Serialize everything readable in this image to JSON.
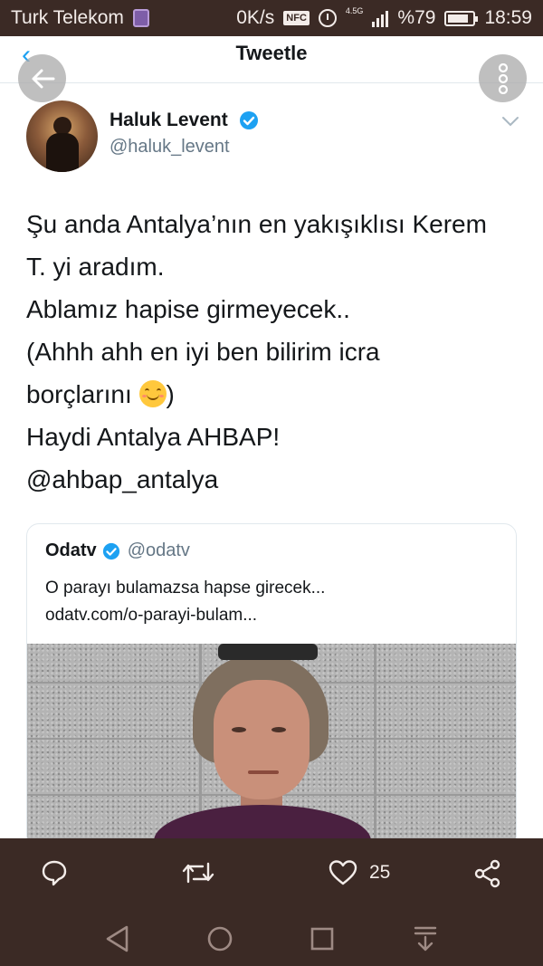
{
  "status_bar": {
    "carrier": "Turk Telekom",
    "speed": "0K/s",
    "nfc": "NFC",
    "network": "4.5G",
    "battery": "%79",
    "time": "18:59"
  },
  "header": {
    "title": "Tweetle"
  },
  "tweet": {
    "author_name": "Haluk Levent",
    "author_handle": "@haluk_levent",
    "lines": [
      "Şu anda Antalya’nın en yakışıklısı Kerem",
      "T. yi aradım.",
      "Ablamız hapise girmeyecek..",
      "(Ahhh ahh en iyi ben bilirim icra",
      "borçlarını",
      ")",
      "Haydi Antalya AHBAP!",
      "@ahbap_antalya"
    ]
  },
  "quote": {
    "name": "Odatv",
    "handle": "@odatv",
    "text": "O parayı bulamazsa hapse girecek...",
    "link": "odatv.com/o-parayi-bulam..."
  },
  "actions": {
    "like_count": "25"
  },
  "icons": {
    "back": "arrow-left-icon",
    "more": "vertical-dots-icon",
    "verified": "verified-badge-icon",
    "caret": "chevron-down-icon",
    "reply": "speech-bubble-icon",
    "retweet": "retweet-icon",
    "like": "heart-icon",
    "share": "share-icon",
    "nav_back": "triangle-back-icon",
    "nav_home": "circle-home-icon",
    "nav_recent": "square-recent-icon",
    "nav_notify": "pull-down-icon"
  },
  "colors": {
    "system_bar": "#3b2a25",
    "twitter_blue": "#1da1f2",
    "secondary_text": "#657786"
  }
}
